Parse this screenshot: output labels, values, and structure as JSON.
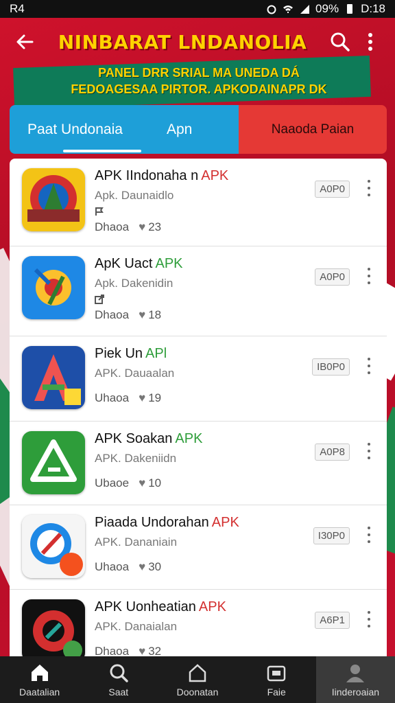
{
  "statusbar": {
    "left": "R4",
    "battery": "09%",
    "time": "D:18"
  },
  "header": {
    "title": "NINBARAT LNDANOLIA",
    "subtitle_line1": "PANEL DRR SRIAL MA UNEDA DÁ",
    "subtitle_line2": "FEDOAGESAA PIRTOR. APKODAINAPR DK"
  },
  "tabs": {
    "tab1": "Paat Undonaia",
    "tab2": "Apn",
    "tab3": "Naaoda Paian"
  },
  "apps": [
    {
      "name": "APK IIndonaha n",
      "tag": "APK",
      "tag_color": "#d32f2f",
      "dev": "Apk. Daunaidlo",
      "label": "Dhaoa",
      "likes": "23",
      "badge": "A0P0"
    },
    {
      "name": "ApK Uact",
      "tag": "APK",
      "tag_color": "#2e9d3a",
      "dev": "Apk. Dakenidin",
      "label": "Dhaoa",
      "likes": "18",
      "badge": "A0P0"
    },
    {
      "name": "Piek Un",
      "tag": "APl",
      "tag_color": "#2e9d3a",
      "dev": "APK. Dauaalan",
      "label": "Uhaoa",
      "likes": "19",
      "badge": "IB0P0"
    },
    {
      "name": "APK Soakan",
      "tag": "APK",
      "tag_color": "#2e9d3a",
      "dev": "APK. Dakeniidn",
      "label": "Ubaoe",
      "likes": "10",
      "badge": "A0P8"
    },
    {
      "name": "Piaada Undorahan",
      "tag": "APK",
      "tag_color": "#d32f2f",
      "dev": "APK. Dananiain",
      "label": "Uhaoa",
      "likes": "30",
      "badge": "I30P0"
    },
    {
      "name": "APK Uonheatian",
      "tag": "APK",
      "tag_color": "#d32f2f",
      "dev": "APK. Danaialan",
      "label": "Dhaoa",
      "likes": "32",
      "badge": "A6P1"
    }
  ],
  "bottomnav": {
    "item1": "Daatalian",
    "item2": "Saat",
    "item3": "Doonatan",
    "item4": "Faie",
    "item5": "Iinderoaian"
  },
  "colors": {
    "tab_blue": "#1e9fd8",
    "tab_red": "#e53935",
    "title_yellow": "#ffd200",
    "background_red": "#c8102e"
  }
}
